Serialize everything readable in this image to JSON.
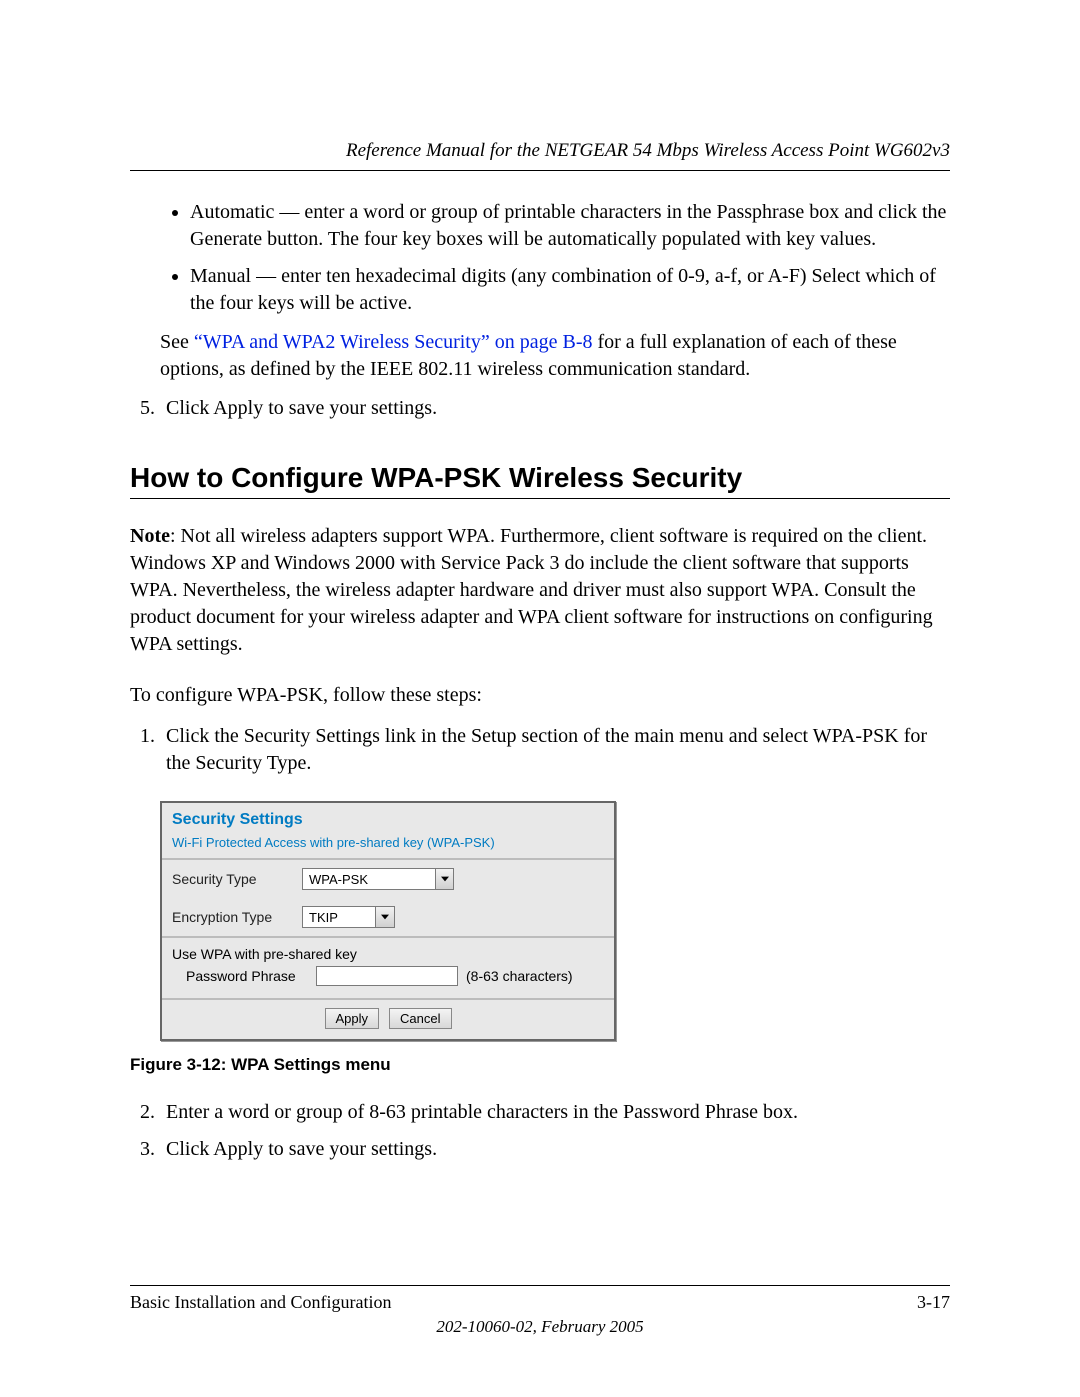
{
  "header": {
    "title": "Reference Manual for the NETGEAR 54 Mbps Wireless Access Point WG602v3"
  },
  "top_bullets": [
    "Automatic — enter a word or group of printable characters in the Passphrase box and click the Generate button. The four key boxes will be automatically populated with key values.",
    "Manual — enter ten hexadecimal digits (any combination of 0-9, a-f, or A-F) Select which of the four keys will be active."
  ],
  "see_para": {
    "prefix": "See ",
    "link": "“WPA and WPA2 Wireless Security” on page B-8",
    "suffix": " for a full explanation of each of these options, as defined by the IEEE 802.11 wireless communication standard."
  },
  "step5": "Click Apply to save your settings.",
  "section_heading": "How to Configure WPA-PSK Wireless Security",
  "note": {
    "label": "Note",
    "text": ": Not all wireless adapters support WPA. Furthermore, client software is required on the client. Windows XP and Windows 2000 with Service Pack 3 do include the client software that supports WPA. Nevertheless, the wireless adapter hardware and driver must also support WPA. Consult the product document for your wireless adapter and WPA client software for instructions on configuring WPA settings."
  },
  "intro_line": "To configure WPA-PSK, follow these steps:",
  "steps": [
    "Click the Security Settings link in the Setup section of the main menu and select WPA-PSK for the Security Type.",
    "Enter a word or group of 8-63 printable characters in the Password Phrase box.",
    "Click Apply to save your settings."
  ],
  "settings": {
    "title": "Security Settings",
    "subtitle": "Wi-Fi Protected Access with pre-shared key (WPA-PSK)",
    "security_type_label": "Security Type",
    "security_type_value": "WPA-PSK",
    "encryption_label": "Encryption Type",
    "encryption_value": "TKIP",
    "psk_section": "Use WPA with pre-shared key",
    "pw_label": "Password Phrase",
    "pw_hint": "(8-63 characters)",
    "apply": "Apply",
    "cancel": "Cancel"
  },
  "figure_caption": "Figure 3-12:  WPA Settings menu",
  "footer": {
    "left": "Basic Installation and Configuration",
    "right": "3-17",
    "sub": "202-10060-02, February 2005"
  }
}
